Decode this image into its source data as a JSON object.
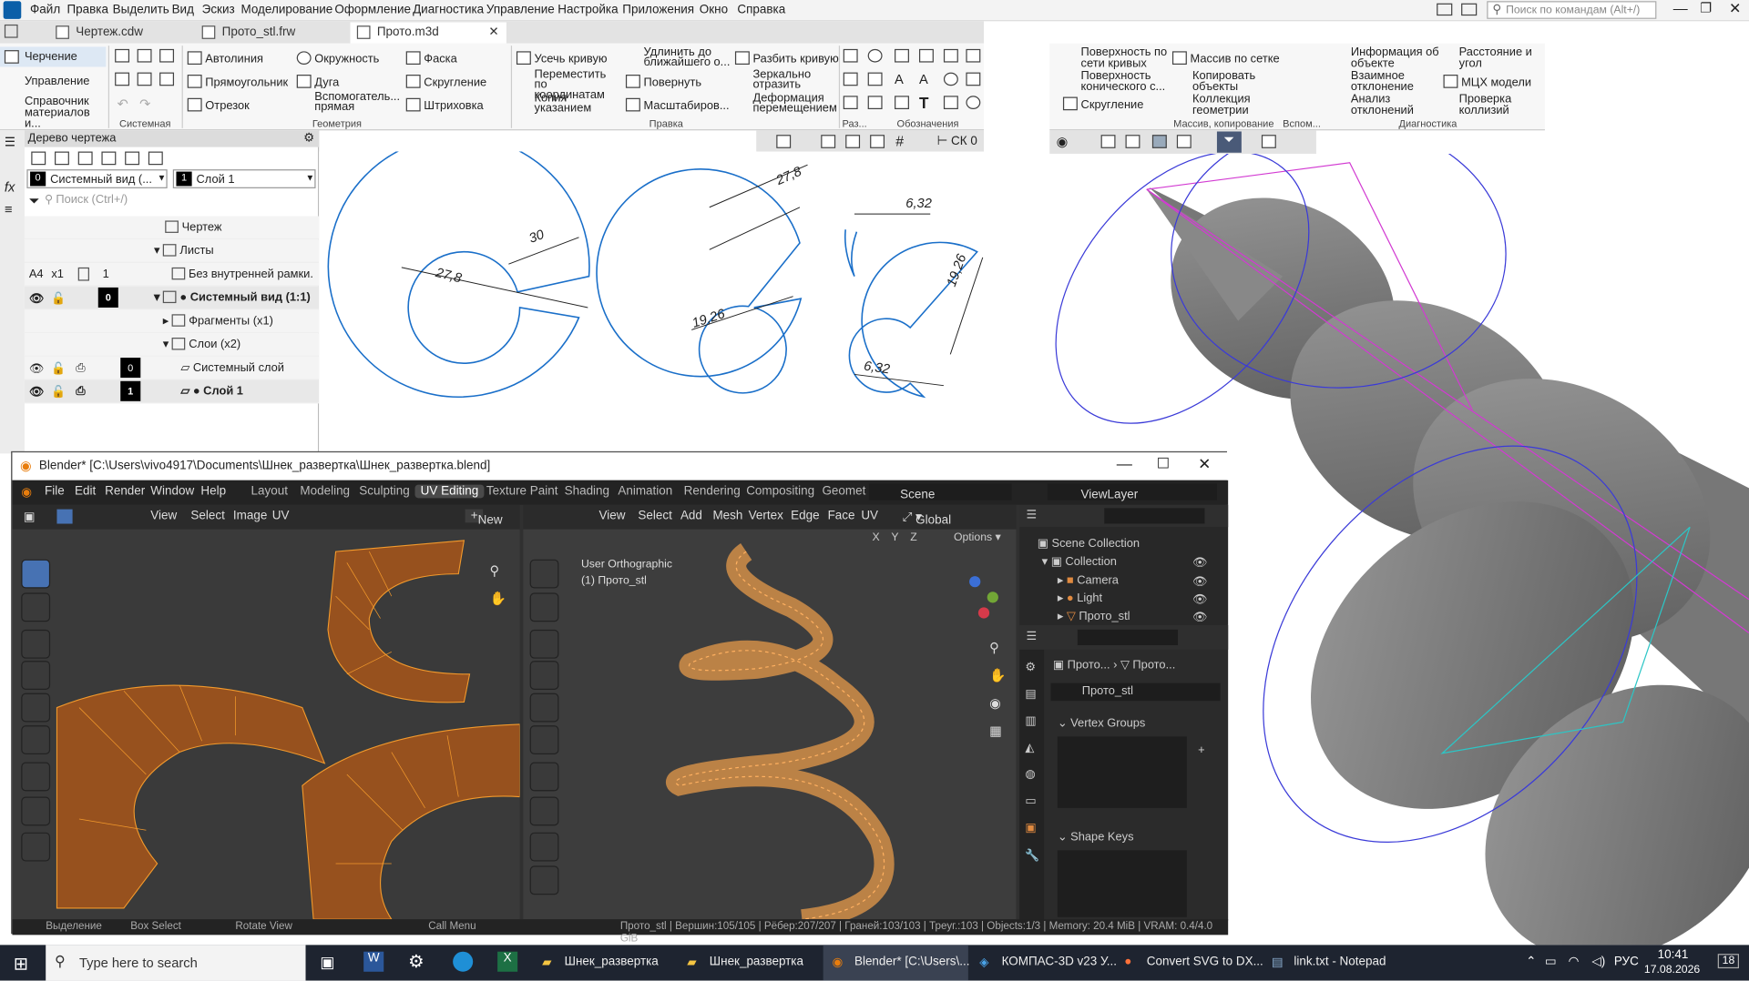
{
  "kompas": {
    "menu": [
      "Файл",
      "Правка",
      "Выделить",
      "Вид",
      "Эскиз",
      "Моделирование",
      "Оформление",
      "Диагностика",
      "Управление",
      "Настройка",
      "Приложения",
      "Окно",
      "Справка"
    ],
    "tabs": [
      "Чертеж.cdw",
      "Прото_stl.frw",
      "Прото.m3d"
    ],
    "search_placeholder": "Поиск по командам (Alt+/)",
    "modes": [
      "Черчение",
      "Управление",
      "Справочник материалов и..."
    ],
    "ribbon": {
      "col1": [
        "Автолиния",
        "Прямоугольник",
        "Отрезок"
      ],
      "col2": [
        "Окружность",
        "Дуга",
        "Вспомогатель... прямая"
      ],
      "col3": [
        "Фаска",
        "Скругление",
        "Штриховка"
      ],
      "col4": [
        "Усечь кривую",
        "Переместить по координатам",
        "Копия указанием"
      ],
      "col5": [
        "Удлинить до ближайшего о...",
        "Повернуть",
        "Масштабиров..."
      ],
      "col6": [
        "Разбить кривую",
        "Зеркально отразить",
        "Деформация перемещением"
      ],
      "groups": [
        "Системная",
        "Геометрия",
        "Правка",
        "Раз...",
        "Обозначения"
      ]
    },
    "ribbon_right": {
      "col1": [
        "Поверхность по сети кривых",
        "Поверхность конического с...",
        "Скругление"
      ],
      "col2": [
        "Массив по сетке",
        "Копировать объекты",
        "Коллекция геометрии"
      ],
      "col3": [
        "Информация об объекте",
        "Взаимное отклонение",
        "Анализ отклонений"
      ],
      "col4": [
        "Расстояние и угол",
        "МЦХ модели",
        "Проверка коллизий"
      ],
      "groups": [
        "Массив, копирование",
        "Вспом...",
        "Диагностика"
      ]
    },
    "tree": {
      "title": "Дерево чертежа",
      "view_select": "Системный вид (...",
      "layer_select": "Слой 1",
      "search_placeholder": "Поиск (Ctrl+/)",
      "rows": [
        "Чертеж",
        "Листы",
        "Без внутренней рамки.",
        "● Системный вид (1:1)",
        "Фрагменты (x1)",
        "Слои (x2)",
        "Системный слой",
        "● Слой 1"
      ],
      "sheet_format": "A4",
      "sheet_mult": "x1",
      "sheet_count": "1",
      "view_num": "0",
      "layer0": "0",
      "layer1": "1"
    },
    "snap": "СК 0",
    "dims": [
      "30",
      "27,8",
      "27,8",
      "19,26",
      "6,32",
      "19,26",
      "6,32"
    ]
  },
  "blender": {
    "title": "Blender* [C:\\Users\\vivo4917\\Documents\\Шнек_развертка\\Шнек_развертка.blend]",
    "menu": [
      "File",
      "Edit",
      "Render",
      "Window",
      "Help"
    ],
    "workspaces": [
      "Layout",
      "Modeling",
      "Sculpting",
      "UV Editing",
      "Texture Paint",
      "Shading",
      "Animation",
      "Rendering",
      "Compositing",
      "Geomet"
    ],
    "scene": "Scene",
    "viewlayer": "ViewLayer",
    "uv_menu": [
      "View",
      "Select",
      "Image",
      "UV"
    ],
    "uv_new": "New",
    "vp_menu": [
      "View",
      "Select",
      "Add",
      "Mesh",
      "Vertex",
      "Edge",
      "Face",
      "UV"
    ],
    "orientation": "Global",
    "axes": [
      "X",
      "Y",
      "Z"
    ],
    "options": "Options",
    "vp_label": "User Orthographic",
    "vp_object": "(1) Прото_stl",
    "outliner": {
      "root": "Scene Collection",
      "collection": "Collection",
      "items": [
        "Camera",
        "Light",
        "Прото_stl"
      ]
    },
    "props": {
      "crumb1": "Прото...",
      "crumb2": "Прото...",
      "data_name": "Прото_stl",
      "panel1": "Vertex Groups",
      "panel2": "Shape Keys"
    },
    "status": {
      "select": "Выделение",
      "box": "Box Select",
      "rotate": "Rotate View",
      "call": "Call Menu",
      "stats": "Прото_stl | Вершин:105/105 | Рёбер:207/207 | Граней:103/103 | Треуг.:103 | Objects:1/3 | Memory: 20.4 MiB | VRAM: 0.4/4.0 GiB"
    }
  },
  "taskbar": {
    "search": "Type here to search",
    "apps": [
      "Шнек_развертка",
      "Шнек_развертка",
      "Blender* [C:\\Users\\...",
      "КОМПАС-3D v23 У...",
      "Convert SVG to DX...",
      "link.txt - Notepad"
    ],
    "lang": "РУС",
    "time": "10:41",
    "date": "17.08.2026",
    "notif": "18"
  },
  "colors": {
    "drawing_blue": "#1a6fc9",
    "uv_orange": "#c46a1f",
    "blender_active": "#4772b3"
  }
}
